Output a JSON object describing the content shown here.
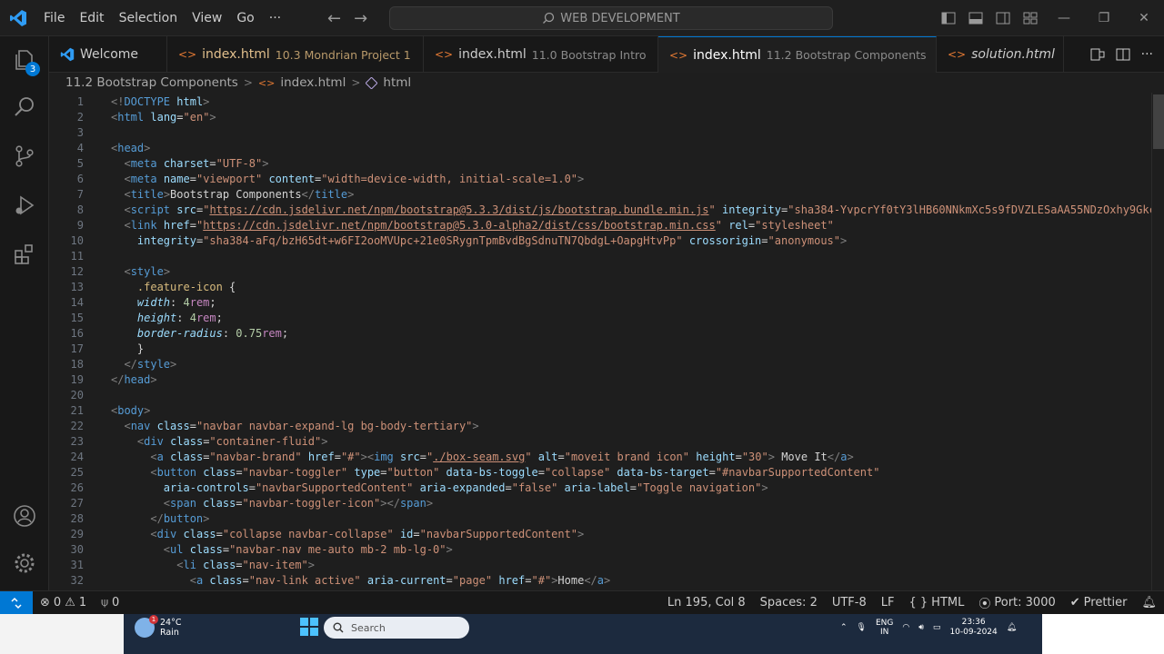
{
  "menu": [
    "File",
    "Edit",
    "Selection",
    "View",
    "Go",
    "···"
  ],
  "search": {
    "text": "WEB DEVELOPMENT"
  },
  "activity": {
    "explorer_badge": "3"
  },
  "tabs": [
    {
      "name": "Welcome",
      "desc": "",
      "active": false
    },
    {
      "name": "index.html",
      "desc": "10.3 Mondrian Project 1",
      "active": false
    },
    {
      "name": "index.html",
      "desc": "11.0 Bootstrap Intro",
      "active": false
    },
    {
      "name": "index.html",
      "desc": "11.2 Bootstrap Components",
      "active": true
    },
    {
      "name": "solution.html",
      "desc": "",
      "active": false
    }
  ],
  "breadcrumb": [
    "11.2 Bootstrap Components",
    "index.html",
    "html"
  ],
  "editor": {
    "line_numbers": [
      "1",
      "2",
      "3",
      "4",
      "5",
      "6",
      "7",
      "8",
      "9",
      "10",
      "11",
      "12",
      "13",
      "14",
      "15",
      "16",
      "17",
      "18",
      "19",
      "20",
      "21",
      "22",
      "23",
      "24",
      "25",
      "26",
      "27",
      "28",
      "29",
      "30",
      "31",
      "32"
    ]
  },
  "status": {
    "errors": "0",
    "warnings": "1",
    "ports": "0",
    "position": "Ln 195, Col 8",
    "spaces": "Spaces: 2",
    "encoding": "UTF-8",
    "eol": "LF",
    "language": "HTML",
    "port": "Port: 3000",
    "formatter": "Prettier"
  },
  "taskbar": {
    "temp": "24°C",
    "weather": "Rain",
    "weather_badge": "1",
    "search_placeholder": "Search",
    "lang1": "ENG",
    "lang2": "IN",
    "time": "23:36",
    "date": "10-09-2024"
  },
  "colors": {
    "accent": "#0078d4",
    "tag": "#569cd6",
    "attr": "#9cdcfe",
    "string": "#ce9178"
  }
}
